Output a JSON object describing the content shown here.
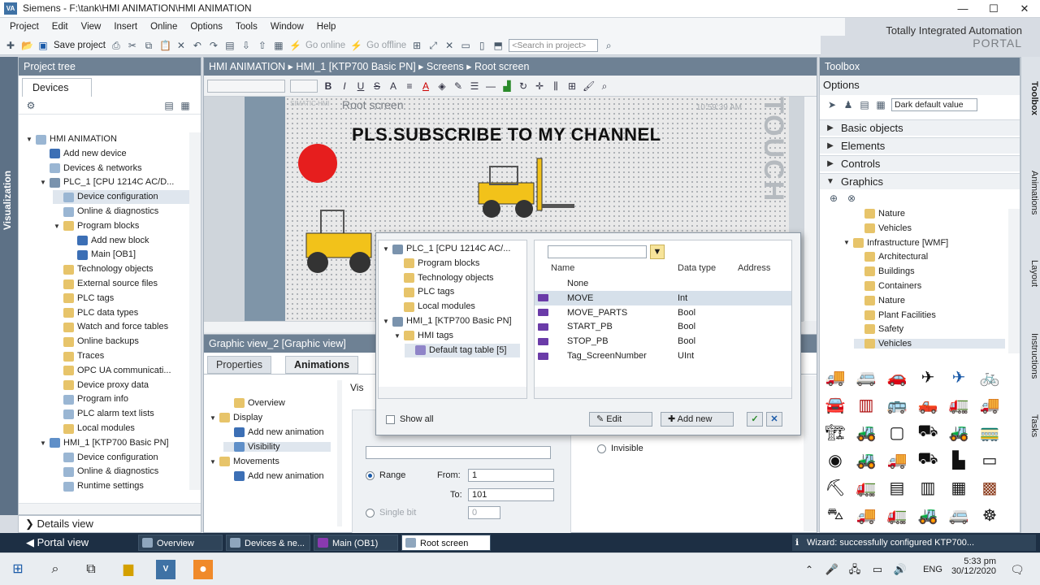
{
  "window": {
    "title": "Siemens - F:\\tank\\HMI ANIMATION\\HMI ANIMATION",
    "app_icon": "VA"
  },
  "menu": [
    "Project",
    "Edit",
    "View",
    "Insert",
    "Online",
    "Options",
    "Tools",
    "Window",
    "Help"
  ],
  "brand": {
    "line1": "Totally Integrated Automation",
    "line2": "PORTAL"
  },
  "toolbar": {
    "save": "Save project",
    "go_online": "Go online",
    "go_offline": "Go offline",
    "search_placeholder": "<Search in project>"
  },
  "project_tree": {
    "header": "Project tree",
    "side_tab": "Visualization",
    "devices_tab": "Devices",
    "items": [
      {
        "label": "HMI ANIMATION",
        "indent": 0,
        "expanded": true,
        "icon": "project"
      },
      {
        "label": "Add new device",
        "indent": 1,
        "icon": "add"
      },
      {
        "label": "Devices & networks",
        "indent": 1,
        "icon": "network"
      },
      {
        "label": "PLC_1 [CPU 1214C AC/D...",
        "indent": 1,
        "expanded": true,
        "icon": "plc"
      },
      {
        "label": "Device configuration",
        "indent": 2,
        "icon": "config",
        "selected": true
      },
      {
        "label": "Online & diagnostics",
        "indent": 2,
        "icon": "diag"
      },
      {
        "label": "Program blocks",
        "indent": 2,
        "expanded": true,
        "icon": "folder"
      },
      {
        "label": "Add new block",
        "indent": 3,
        "icon": "add"
      },
      {
        "label": "Main [OB1]",
        "indent": 3,
        "icon": "block"
      },
      {
        "label": "Technology objects",
        "indent": 2,
        "icon": "folder"
      },
      {
        "label": "External source files",
        "indent": 2,
        "icon": "folder"
      },
      {
        "label": "PLC tags",
        "indent": 2,
        "icon": "folder"
      },
      {
        "label": "PLC data types",
        "indent": 2,
        "icon": "folder"
      },
      {
        "label": "Watch and force tables",
        "indent": 2,
        "icon": "folder"
      },
      {
        "label": "Online backups",
        "indent": 2,
        "icon": "folder"
      },
      {
        "label": "Traces",
        "indent": 2,
        "icon": "folder"
      },
      {
        "label": "OPC UA communicati...",
        "indent": 2,
        "icon": "folder"
      },
      {
        "label": "Device proxy data",
        "indent": 2,
        "icon": "folder"
      },
      {
        "label": "Program info",
        "indent": 2,
        "icon": "info"
      },
      {
        "label": "PLC alarm text lists",
        "indent": 2,
        "icon": "list"
      },
      {
        "label": "Local modules",
        "indent": 2,
        "icon": "folder"
      },
      {
        "label": "HMI_1 [KTP700 Basic PN]",
        "indent": 1,
        "expanded": true,
        "icon": "hmi"
      },
      {
        "label": "Device configuration",
        "indent": 2,
        "icon": "config"
      },
      {
        "label": "Online & diagnostics",
        "indent": 2,
        "icon": "diag"
      },
      {
        "label": "Runtime settings",
        "indent": 2,
        "icon": "settings"
      }
    ],
    "details": "Details view"
  },
  "editor": {
    "breadcrumb": "HMI ANIMATION  ▸  HMI_1 [KTP700 Basic PN]  ▸  Screens  ▸  Root screen",
    "screen_label": "Root screen",
    "clock": "10:59:39 AM",
    "touch_text": "TOUCH",
    "headline": "PLS.SUBSCRIBE TO MY CHANNEL",
    "simatic": "SIMATIC HMI"
  },
  "properties": {
    "header": "Graphic view_2 [Graphic view]",
    "tabs": [
      "Properties",
      "Animations"
    ],
    "active_tab": "Animations",
    "tree": [
      {
        "label": "Overview",
        "indent": 1
      },
      {
        "label": "Display",
        "indent": 0,
        "expanded": true
      },
      {
        "label": "Add new animation",
        "indent": 1,
        "icon": "add"
      },
      {
        "label": "Visibility",
        "indent": 1,
        "icon": "eye",
        "selected": true
      },
      {
        "label": "Movements",
        "indent": 0,
        "expanded": true
      },
      {
        "label": "Add new animation",
        "indent": 1,
        "icon": "add"
      }
    ],
    "vis_label": "Vis",
    "range_label": "Range",
    "from_label": "From:",
    "from_value": "1",
    "to_label": "To:",
    "to_value": "101",
    "single_bit_label": "Single bit",
    "single_bit_value": "0",
    "invisible_label": "Invisible"
  },
  "popup": {
    "tree": [
      {
        "label": "PLC_1 [CPU 1214C AC/...",
        "indent": 0,
        "expanded": true
      },
      {
        "label": "Program blocks",
        "indent": 1
      },
      {
        "label": "Technology objects",
        "indent": 1
      },
      {
        "label": "PLC tags",
        "indent": 1
      },
      {
        "label": "Local modules",
        "indent": 1
      },
      {
        "label": "HMI_1 [KTP700 Basic PN]",
        "indent": 0,
        "expanded": true
      },
      {
        "label": "HMI tags",
        "indent": 1,
        "expanded": true
      },
      {
        "label": "Default tag table [5]",
        "indent": 2,
        "selected": true
      }
    ],
    "columns": {
      "name": "Name",
      "datatype": "Data type",
      "address": "Address"
    },
    "rows": [
      {
        "name": "None",
        "datatype": ""
      },
      {
        "name": "MOVE",
        "datatype": "Int",
        "selected": true
      },
      {
        "name": "MOVE_PARTS",
        "datatype": "Bool"
      },
      {
        "name": "START_PB",
        "datatype": "Bool"
      },
      {
        "name": "STOP_PB",
        "datatype": "Bool"
      },
      {
        "name": "Tag_ScreenNumber",
        "datatype": "UInt"
      }
    ],
    "show_all": "Show all",
    "edit": "Edit",
    "add_new": "Add new"
  },
  "toolbox": {
    "header": "Toolbox",
    "options": "Options",
    "style": "Dark default value",
    "sections": [
      "Basic objects",
      "Elements",
      "Controls",
      "Graphics"
    ],
    "graphics_tree": [
      {
        "label": "Nature",
        "indent": 2
      },
      {
        "label": "Vehicles",
        "indent": 2
      },
      {
        "label": "Infrastructure [WMF]",
        "indent": 1,
        "expanded": true
      },
      {
        "label": "Architectural",
        "indent": 2
      },
      {
        "label": "Buildings",
        "indent": 2
      },
      {
        "label": "Containers",
        "indent": 2
      },
      {
        "label": "Nature",
        "indent": 2
      },
      {
        "label": "Plant Facilities",
        "indent": 2
      },
      {
        "label": "Safety",
        "indent": 2
      },
      {
        "label": "Vehicles",
        "indent": 2,
        "selected": true
      }
    ],
    "side_tabs": [
      "Toolbox",
      "Animations",
      "Layout",
      "Instructions",
      "Tasks"
    ]
  },
  "statusbar": {
    "portal": "Portal view",
    "tabs": [
      "Overview",
      "Devices & ne...",
      "Main (OB1)",
      "Root screen"
    ],
    "active_tab": "Root screen",
    "wizard": "Wizard: successfully configured KTP700..."
  },
  "taskbar": {
    "lang": "ENG",
    "time": "5:33 pm",
    "date": "30/12/2020"
  }
}
